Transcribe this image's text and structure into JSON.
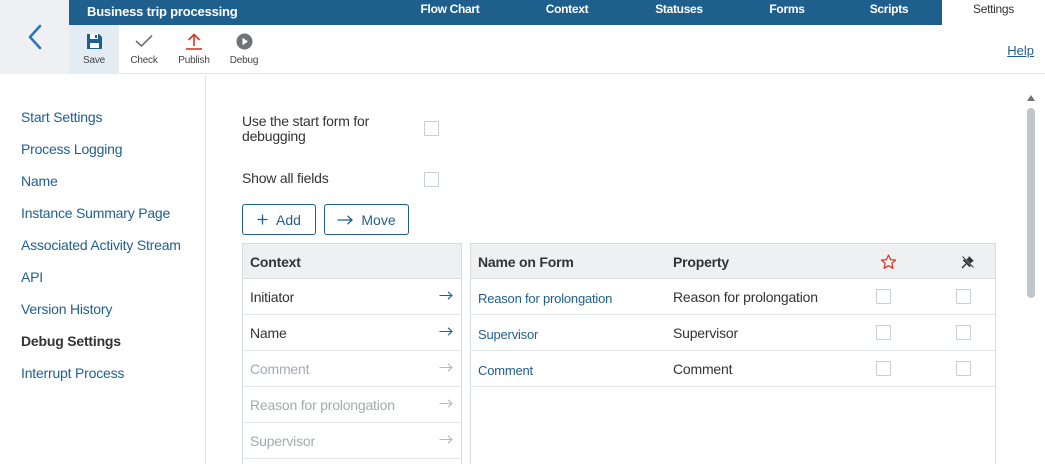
{
  "app": {
    "title": "Business trip processing",
    "help_label": "Help"
  },
  "tabs": [
    {
      "label": "Flow Chart"
    },
    {
      "label": "Context"
    },
    {
      "label": "Statuses"
    },
    {
      "label": "Forms"
    },
    {
      "label": "Scripts"
    },
    {
      "label": "Settings",
      "active": true
    }
  ],
  "toolbar": {
    "save_label": "Save",
    "check_label": "Check",
    "publish_label": "Publish",
    "debug_label": "Debug"
  },
  "sidebar": {
    "items": [
      {
        "label": "Start Settings"
      },
      {
        "label": "Process Logging"
      },
      {
        "label": "Name"
      },
      {
        "label": "Instance Summary Page"
      },
      {
        "label": "Associated Activity Stream"
      },
      {
        "label": "API"
      },
      {
        "label": "Version History"
      },
      {
        "label": "Debug Settings",
        "current": true
      },
      {
        "label": "Interrupt Process"
      }
    ]
  },
  "debug": {
    "use_start_form_line1": "Use the start form for",
    "use_start_form_line2": "debugging",
    "use_start_form_checked": false,
    "show_all_fields_label": "Show all fields",
    "show_all_fields_checked": false,
    "add_label": "Add",
    "move_label": "Move"
  },
  "context_table": {
    "header": "Context",
    "rows": [
      {
        "label": "Initiator",
        "enabled": true
      },
      {
        "label": "Name",
        "enabled": true
      },
      {
        "label": "Comment",
        "enabled": false
      },
      {
        "label": "Reason for prolongation",
        "enabled": false
      },
      {
        "label": "Supervisor",
        "enabled": false
      }
    ]
  },
  "form_table": {
    "headers": {
      "name": "Name on Form",
      "property": "Property"
    },
    "rows": [
      {
        "name": "Reason for prolongation",
        "property": "Reason for prolongation",
        "required": false,
        "readonly": false
      },
      {
        "name": "Supervisor",
        "property": "Supervisor",
        "required": false,
        "readonly": false
      },
      {
        "name": "Comment",
        "property": "Comment",
        "required": false,
        "readonly": false
      }
    ]
  },
  "colors": {
    "brand": "#1f5f8e",
    "publish_red": "#e0311f",
    "required_star": "#e0311f"
  },
  "icons": {
    "back": "chevron-left-icon",
    "save": "floppy-disk-icon",
    "check": "checkmark-icon",
    "publish": "upload-arrow-icon",
    "debug": "play-circle-icon",
    "required_column": "star-icon",
    "readonly_column": "pin-icon",
    "add": "plus-icon",
    "move": "arrow-right-icon"
  }
}
